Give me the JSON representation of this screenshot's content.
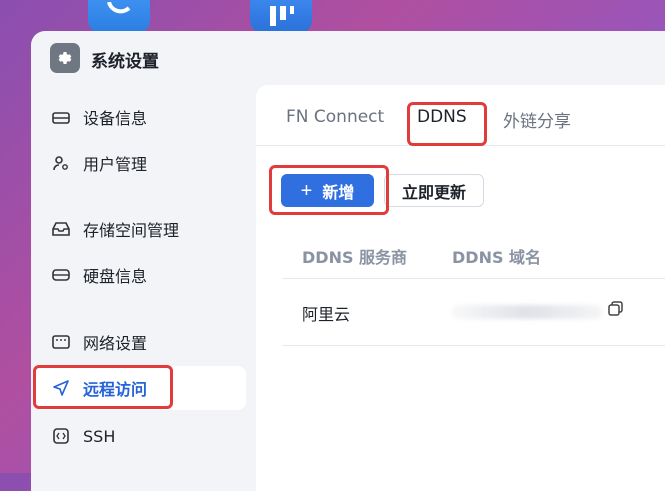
{
  "window": {
    "title": "系统设置"
  },
  "sidebar": {
    "items": [
      {
        "label": "设备信息"
      },
      {
        "label": "用户管理"
      },
      {
        "label": "存储空间管理"
      },
      {
        "label": "硬盘信息"
      },
      {
        "label": "网络设置"
      },
      {
        "label": "远程访问",
        "active": true
      },
      {
        "label": "SSH"
      }
    ]
  },
  "tabs": [
    {
      "label": "FN Connect"
    },
    {
      "label": "DDNS",
      "active": true
    },
    {
      "label": "外链分享"
    }
  ],
  "toolbar": {
    "add_label": "新增",
    "add_icon": "+",
    "refresh_label": "立即更新"
  },
  "table": {
    "columns": [
      "DDNS 服务商",
      "DDNS 域名"
    ],
    "rows": [
      {
        "provider": "阿里云"
      }
    ]
  },
  "colors": {
    "accent": "#2f6fe0",
    "highlight": "#e23b3b"
  }
}
